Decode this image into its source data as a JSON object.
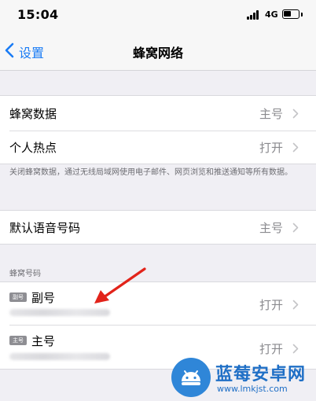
{
  "status_bar": {
    "time": "15:04",
    "network": "4G",
    "battery_level": 0.55
  },
  "nav": {
    "back_label": "设置",
    "title": "蜂窝网络"
  },
  "group1": {
    "cellular_data": {
      "label": "蜂窝数据",
      "value": "主号"
    },
    "hotspot": {
      "label": "个人热点",
      "value": "打开"
    }
  },
  "footnote": "关闭蜂窝数据，通过无线局域网使用电子邮件、网页浏览和推送通知等所有数据。",
  "group2": {
    "default_voice": {
      "label": "默认语音号码",
      "value": "主号"
    }
  },
  "section_header": "蜂窝号码",
  "sim_list": [
    {
      "badge": "副号",
      "name": "副号",
      "value": "打开"
    },
    {
      "badge": "主号",
      "name": "主号",
      "value": "打开"
    }
  ],
  "watermark": {
    "title": "蓝莓安卓网",
    "url": "www.lmkjst.com"
  },
  "colors": {
    "accent": "#1a7cf5",
    "annotation_arrow": "#e2231a",
    "background": "#f0eff4"
  },
  "icons": [
    "back-chevron-icon",
    "signal-icon",
    "battery-icon",
    "chevron-right-icon",
    "sim-badge-icon",
    "android-icon"
  ]
}
